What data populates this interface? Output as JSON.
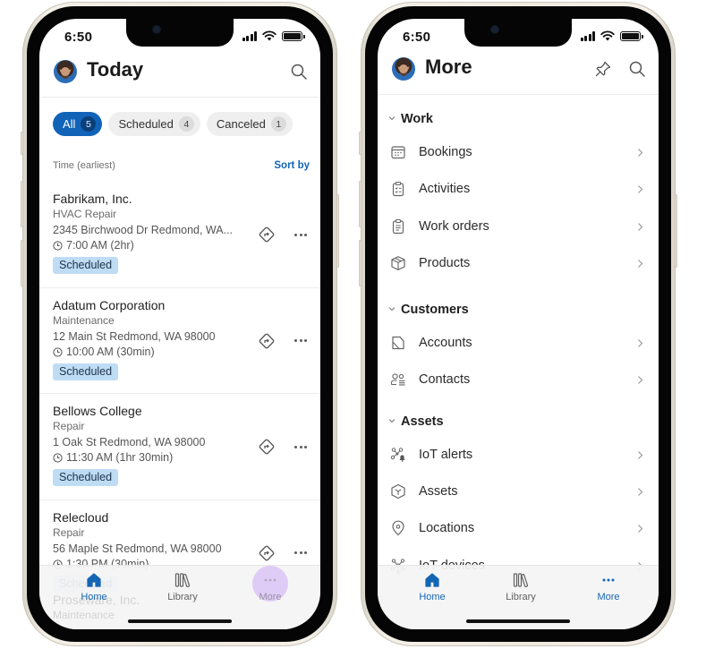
{
  "status_bar": {
    "time": "6:50"
  },
  "today_screen": {
    "title": "Today",
    "filters": [
      {
        "label": "All",
        "count": "5",
        "active": true
      },
      {
        "label": "Scheduled",
        "count": "4",
        "active": false
      },
      {
        "label": "Canceled",
        "count": "1",
        "active": false
      }
    ],
    "sort_label": "Time (earliest)",
    "sort_link": "Sort by",
    "bookings": [
      {
        "name": "Fabrikam, Inc.",
        "type": "HVAC Repair",
        "address": "2345 Birchwood Dr Redmond, WA...",
        "time": "7:00 AM (2hr)",
        "status": "Scheduled"
      },
      {
        "name": "Adatum Corporation",
        "type": "Maintenance",
        "address": "12 Main St Redmond, WA 98000",
        "time": "10:00 AM (30min)",
        "status": "Scheduled"
      },
      {
        "name": "Bellows College",
        "type": "Repair",
        "address": "1 Oak St Redmond, WA 98000",
        "time": "11:30 AM (1hr 30min)",
        "status": "Scheduled"
      },
      {
        "name": "Relecloud",
        "type": "Repair",
        "address": "56 Maple St Redmond, WA 98000",
        "time": "1:30 PM (30min)",
        "status": "Scheduled"
      }
    ],
    "partially_hidden": {
      "name": "Proseware, Inc.",
      "type": "Maintenance"
    }
  },
  "more_screen": {
    "title": "More",
    "sections": [
      {
        "title": "Work",
        "items": [
          {
            "label": "Bookings",
            "icon": "calendar-icon"
          },
          {
            "label": "Activities",
            "icon": "clipboard-checklist-icon"
          },
          {
            "label": "Work orders",
            "icon": "clipboard-icon"
          },
          {
            "label": "Products",
            "icon": "box-icon"
          }
        ]
      },
      {
        "title": "Customers",
        "items": [
          {
            "label": "Accounts",
            "icon": "account-icon"
          },
          {
            "label": "Contacts",
            "icon": "contacts-icon"
          }
        ]
      },
      {
        "title": "Assets",
        "items": [
          {
            "label": "IoT alerts",
            "icon": "iot-alert-icon"
          },
          {
            "label": "Assets",
            "icon": "cube-icon"
          },
          {
            "label": "Locations",
            "icon": "location-pin-icon"
          },
          {
            "label": "IoT devices",
            "icon": "iot-devices-icon"
          }
        ]
      }
    ]
  },
  "tab_bar": {
    "tabs": [
      {
        "label": "Home",
        "icon": "home-icon"
      },
      {
        "label": "Library",
        "icon": "library-icon"
      },
      {
        "label": "More",
        "icon": "more-icon"
      }
    ]
  },
  "colors": {
    "accent": "#1163b8",
    "link": "#1565b5",
    "badge_bg": "#bfdcf5",
    "tap_highlight": "#d5bcf6"
  }
}
